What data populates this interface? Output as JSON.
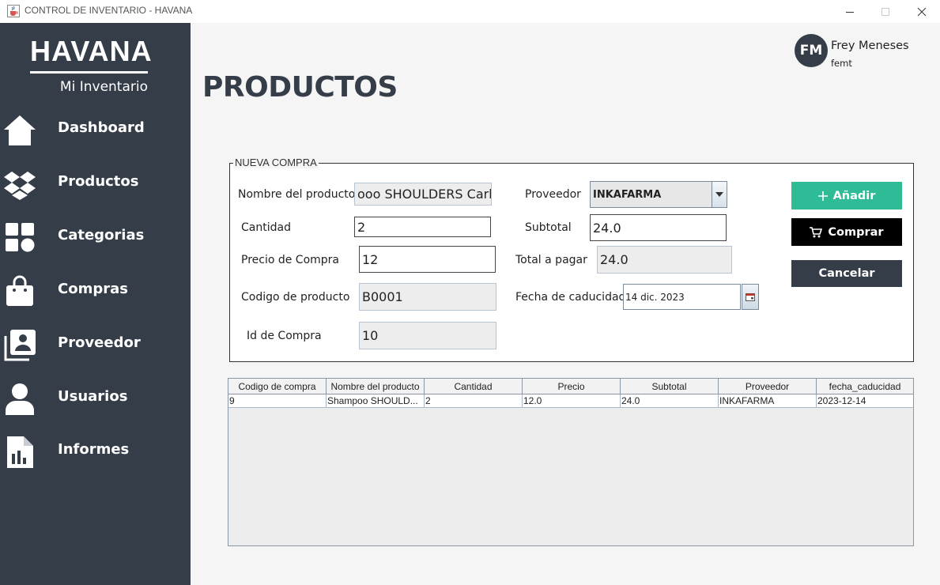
{
  "window": {
    "title": "CONTROL DE INVENTARIO - HAVANA",
    "icons": [
      "java-cup-icon",
      "minimize-icon",
      "maximize-icon",
      "close-icon"
    ]
  },
  "sidebar": {
    "brand": "HAVANA",
    "subtitle": "Mi Inventario",
    "items": [
      {
        "label": "Dashboard",
        "icon": "home-icon"
      },
      {
        "label": "Productos",
        "icon": "dropbox-icon"
      },
      {
        "label": "Categorias",
        "icon": "grid-icon"
      },
      {
        "label": "Compras",
        "icon": "shopping-bag-icon"
      },
      {
        "label": "Proveedor",
        "icon": "contacts-icon"
      },
      {
        "label": "Usuarios",
        "icon": "user-icon"
      },
      {
        "label": "Informes",
        "icon": "report-icon"
      }
    ]
  },
  "user": {
    "initials": "FM",
    "name": "Frey Meneses",
    "login": "femt"
  },
  "page": {
    "title": "PRODUCTOS"
  },
  "form": {
    "legend": "NUEVA COMPRA",
    "labels": {
      "product_name": "Nombre del producto",
      "quantity": "Cantidad",
      "purchase_price": "Precio de Compra",
      "product_code": "Codigo de producto",
      "purchase_id": "Id de Compra",
      "supplier": "Proveedor",
      "subtotal": "Subtotal",
      "total": "Total a pagar",
      "expiry": "Fecha de caducidad"
    },
    "values": {
      "product_name": "ooo SHOULDERS Carbón",
      "quantity": "2",
      "purchase_price": "12",
      "product_code": "B0001",
      "purchase_id": "10",
      "supplier": "INKAFARMA",
      "subtotal": "24.0",
      "total": "24.0",
      "expiry": "14 dic. 2023"
    },
    "buttons": {
      "add": "Añadir",
      "buy": "Comprar",
      "cancel": "Cancelar"
    }
  },
  "table": {
    "columns": [
      "Codigo de compra",
      "Nombre del producto",
      "Cantidad",
      "Precio",
      "Subtotal",
      "Proveedor",
      "fecha_caducidad"
    ],
    "rows": [
      [
        "9",
        "Shampoo SHOULD...",
        "2",
        "12.0",
        "24.0",
        "INKAFARMA",
        "2023-12-14"
      ]
    ]
  },
  "colors": {
    "sidebar": "#353d49",
    "add_button": "#2fbb95",
    "buy_button": "#000000",
    "cancel_button": "#353d49",
    "background": "#f5f5f5"
  }
}
